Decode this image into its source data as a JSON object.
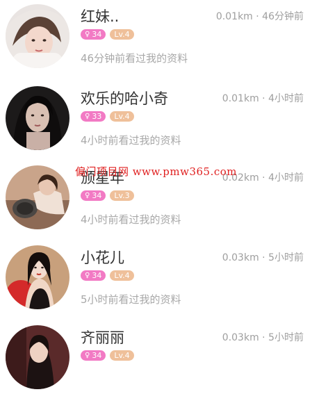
{
  "users": [
    {
      "name": "红妹..",
      "distance": "0.01km",
      "time": "46分钟前",
      "gender_icon": "female-icon",
      "age": "34",
      "level": "Lv.4",
      "activity": "46分钟前看过我的资料",
      "avatar_bg": "#e9e4e2"
    },
    {
      "name": "欢乐的哈小奇",
      "distance": "0.01km",
      "time": "4小时前",
      "gender_icon": "female-icon",
      "age": "33",
      "level": "Lv.4",
      "activity": "4小时前看过我的资料",
      "avatar_bg": "#2a2626"
    },
    {
      "name": "颁星年",
      "distance": "0.02km",
      "time": "4小时前",
      "gender_icon": "female-icon",
      "age": "34",
      "level": "Lv.3",
      "activity": "4小时前看过我的资料",
      "avatar_bg": "#c9a48a"
    },
    {
      "name": "小花儿",
      "distance": "0.03km",
      "time": "5小时前",
      "gender_icon": "female-icon",
      "age": "34",
      "level": "Lv.4",
      "activity": "5小时前看过我的资料",
      "avatar_bg": "#c8a07c"
    },
    {
      "name": "齐丽丽",
      "distance": "0.03km",
      "time": "5小时前",
      "gender_icon": "female-icon",
      "age": "34",
      "level": "Lv.4",
      "activity": "",
      "avatar_bg": "#5a2a2a"
    }
  ],
  "separator": " · ",
  "watermark": "偏门项目网 www.pmw365.com",
  "colors": {
    "gender_badge": "#f27ac4",
    "level_badge": "#efc09a",
    "name_text": "#333333",
    "meta_text": "#9e9e9e"
  }
}
